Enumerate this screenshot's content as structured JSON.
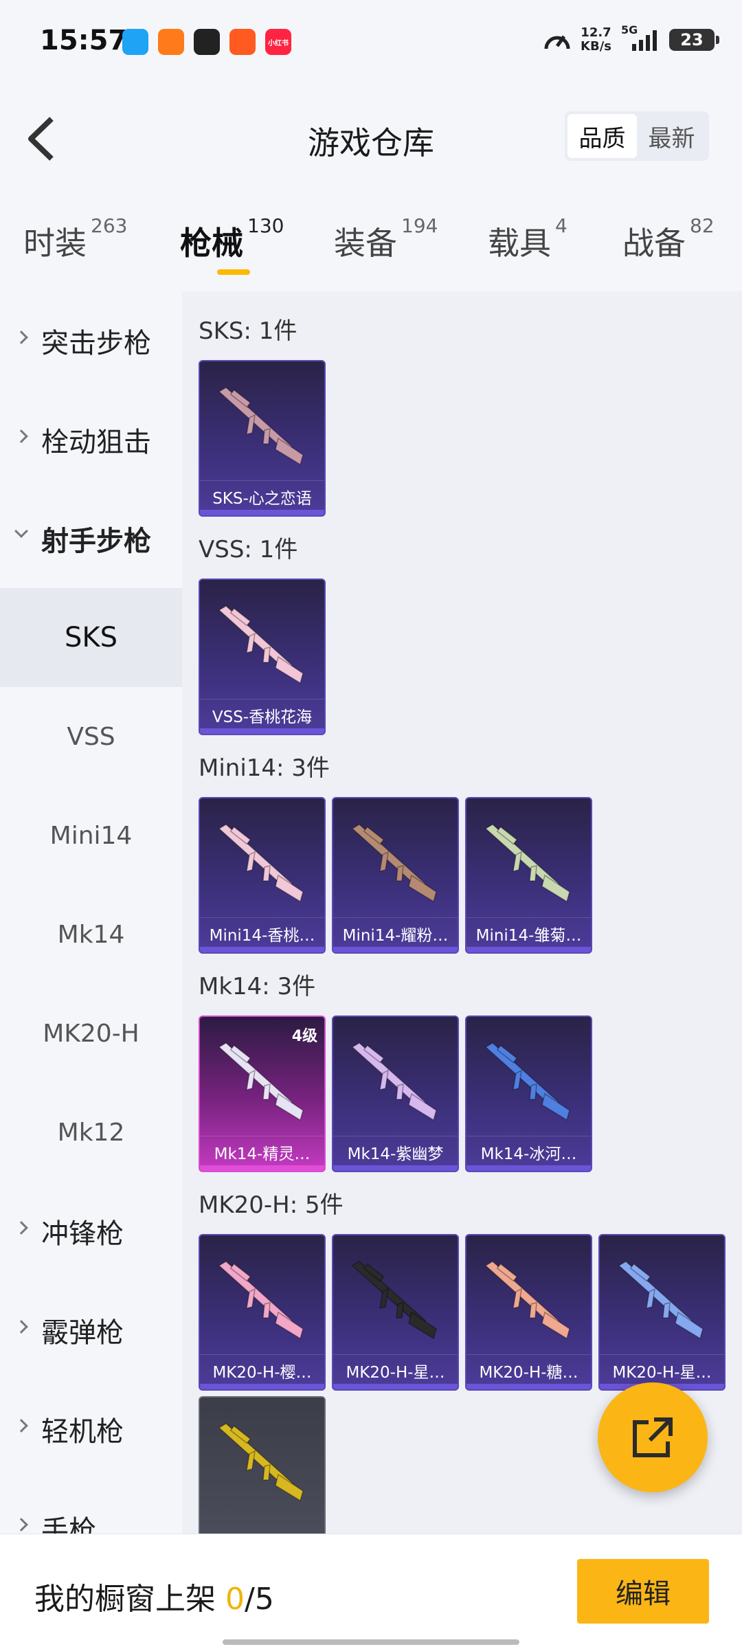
{
  "status_bar": {
    "time": "15:57",
    "net_speed_value": "12.7",
    "net_speed_unit": "KB/s",
    "signal_label": "5G",
    "battery": "23",
    "app_icons": [
      {
        "name": "qq-icon",
        "color": "#1fa3f5",
        "text": ""
      },
      {
        "name": "game-app-icon",
        "color": "#ff7a1a",
        "text": ""
      },
      {
        "name": "missed-call-icon",
        "color": "#222222",
        "text": ""
      },
      {
        "name": "video-app-icon",
        "color": "#ff5a1f",
        "text": ""
      },
      {
        "name": "xiaohongshu-icon",
        "color": "#ff2442",
        "text": "小红书"
      }
    ]
  },
  "header": {
    "title": "游戏仓库",
    "sort_options": [
      {
        "label": "品质",
        "active": true
      },
      {
        "label": "最新",
        "active": false
      }
    ]
  },
  "category_tabs": [
    {
      "label": "时装",
      "count": "263",
      "active": false
    },
    {
      "label": "枪械",
      "count": "130",
      "active": true
    },
    {
      "label": "装备",
      "count": "194",
      "active": false
    },
    {
      "label": "载具",
      "count": "4",
      "active": false
    },
    {
      "label": "战备",
      "count": "82",
      "active": false
    }
  ],
  "sidebar": {
    "groups": [
      {
        "label": "突击步枪",
        "expanded": false
      },
      {
        "label": "栓动狙击",
        "expanded": false
      },
      {
        "label": "射手步枪",
        "expanded": true
      },
      {
        "label": "冲锋枪",
        "expanded": false
      },
      {
        "label": "霰弹枪",
        "expanded": false
      },
      {
        "label": "轻机枪",
        "expanded": false
      },
      {
        "label": "手枪",
        "expanded": false
      }
    ],
    "sub_items": [
      {
        "label": "SKS",
        "active": true
      },
      {
        "label": "VSS",
        "active": false
      },
      {
        "label": "Mini14",
        "active": false
      },
      {
        "label": "Mk14",
        "active": false
      },
      {
        "label": "MK20-H",
        "active": false
      },
      {
        "label": "Mk12",
        "active": false
      }
    ]
  },
  "sections": [
    {
      "title": "SKS: 1件",
      "items": [
        {
          "name": "SKS-心之恋语",
          "rarity": "purple",
          "level": "",
          "gun_color": "#c89aa8"
        }
      ]
    },
    {
      "title": "VSS: 1件",
      "items": [
        {
          "name": "VSS-香桃花海",
          "rarity": "purple",
          "level": "",
          "gun_color": "#f2c6d6"
        }
      ]
    },
    {
      "title": "Mini14: 3件",
      "items": [
        {
          "name": "Mini14-香桃…",
          "rarity": "purple",
          "level": "",
          "gun_color": "#f0c8d8"
        },
        {
          "name": "Mini14-耀粉…",
          "rarity": "purple",
          "level": "",
          "gun_color": "#b58a72"
        },
        {
          "name": "Mini14-雏菊…",
          "rarity": "purple",
          "level": "",
          "gun_color": "#c9d8b0"
        }
      ]
    },
    {
      "title": "Mk14: 3件",
      "items": [
        {
          "name": "Mk14-精灵…",
          "rarity": "pink",
          "level": "4级",
          "gun_color": "#e8e2f5"
        },
        {
          "name": "Mk14-紫幽梦",
          "rarity": "purple",
          "level": "",
          "gun_color": "#d7b8ee"
        },
        {
          "name": "Mk14-冰河…",
          "rarity": "purple",
          "level": "",
          "gun_color": "#4f7fe0"
        }
      ]
    },
    {
      "title": "MK20-H: 5件",
      "items": [
        {
          "name": "MK20-H-樱…",
          "rarity": "purple",
          "level": "",
          "gun_color": "#f2a6c8"
        },
        {
          "name": "MK20-H-星…",
          "rarity": "purple",
          "level": "",
          "gun_color": "#2a2a2a"
        },
        {
          "name": "MK20-H-糖…",
          "rarity": "purple",
          "level": "",
          "gun_color": "#f0a890"
        },
        {
          "name": "MK20-H-星…",
          "rarity": "purple",
          "level": "",
          "gun_color": "#86a8f0"
        },
        {
          "name": "",
          "rarity": "gray",
          "level": "",
          "gun_color": "#d8b820"
        }
      ]
    }
  ],
  "footer": {
    "shelf_label": "我的橱窗上架",
    "shelf_current": "0",
    "shelf_total": "/5",
    "edit_label": "编辑"
  },
  "colors": {
    "accent": "#fbb515",
    "active_underline": "#fcb900",
    "purple_card": "#3b2f78",
    "pink_card": "#c43bc2"
  }
}
